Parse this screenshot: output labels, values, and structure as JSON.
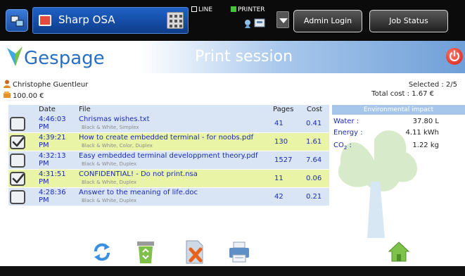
{
  "topbar": {
    "device_name": "Sharp OSA",
    "status_line": "LINE",
    "status_printer": "PRINTER",
    "admin_login": "Admin Login",
    "job_status": "Job Status"
  },
  "header": {
    "logo": "Gespage",
    "title": "Print session"
  },
  "user": {
    "name": "Christophe Guentleur",
    "credit": "100.00 €"
  },
  "summary": {
    "selected": "Selected : 2/5",
    "total_cost": "Total cost : 1.67 €"
  },
  "table": {
    "columns": {
      "date": "Date",
      "file": "File",
      "pages": "Pages",
      "cost": "Cost"
    },
    "rows": [
      {
        "selected": false,
        "time": "4:46:03",
        "ampm": "PM",
        "file": "Chrismas wishes.txt",
        "details": "Black & White, Simplex",
        "pages": "41",
        "cost": "0.41"
      },
      {
        "selected": true,
        "time": "4:39:21",
        "ampm": "PM",
        "file": "How to create embedded terminal - for noobs.pdf",
        "details": "Black & White, Color, Duplex",
        "pages": "130",
        "cost": "1.61"
      },
      {
        "selected": false,
        "time": "4:32:13",
        "ampm": "PM",
        "file": "Easy embedded terminal developpment theory.pdf",
        "details": "Black & White, Duplex",
        "pages": "1527",
        "cost": "7.64"
      },
      {
        "selected": true,
        "time": "4:31:51",
        "ampm": "PM",
        "file": "CONFIDENTIAL! - Do not print.nsa",
        "details": "Black & White, Duplex",
        "pages": "11",
        "cost": "0.06"
      },
      {
        "selected": false,
        "time": "4:28:36",
        "ampm": "PM",
        "file": "Answer to the meaning of life.doc",
        "details": "Black & White, Duplex",
        "pages": "42",
        "cost": "0.21"
      }
    ]
  },
  "environment": {
    "heading": "Environmental impact",
    "water_label": "Water :",
    "water_value": "37.80 L",
    "energy_label": "Energy :",
    "energy_value": "4.11 kWh",
    "co2_label": "CO",
    "co2_sub": "2",
    "co2_colon": " :",
    "co2_value": "1.22 kg"
  },
  "colors": {
    "accent_blue": "#2a6fbf",
    "selected_row": "#e9f4a6",
    "unselected_row": "#d9e5f5",
    "link_text": "#1a2bb5",
    "power_red": "#d41a10"
  },
  "icons": [
    "home-icon",
    "refresh-icon",
    "recycle-bin-icon",
    "delete-icon",
    "printer-icon",
    "power-icon"
  ]
}
